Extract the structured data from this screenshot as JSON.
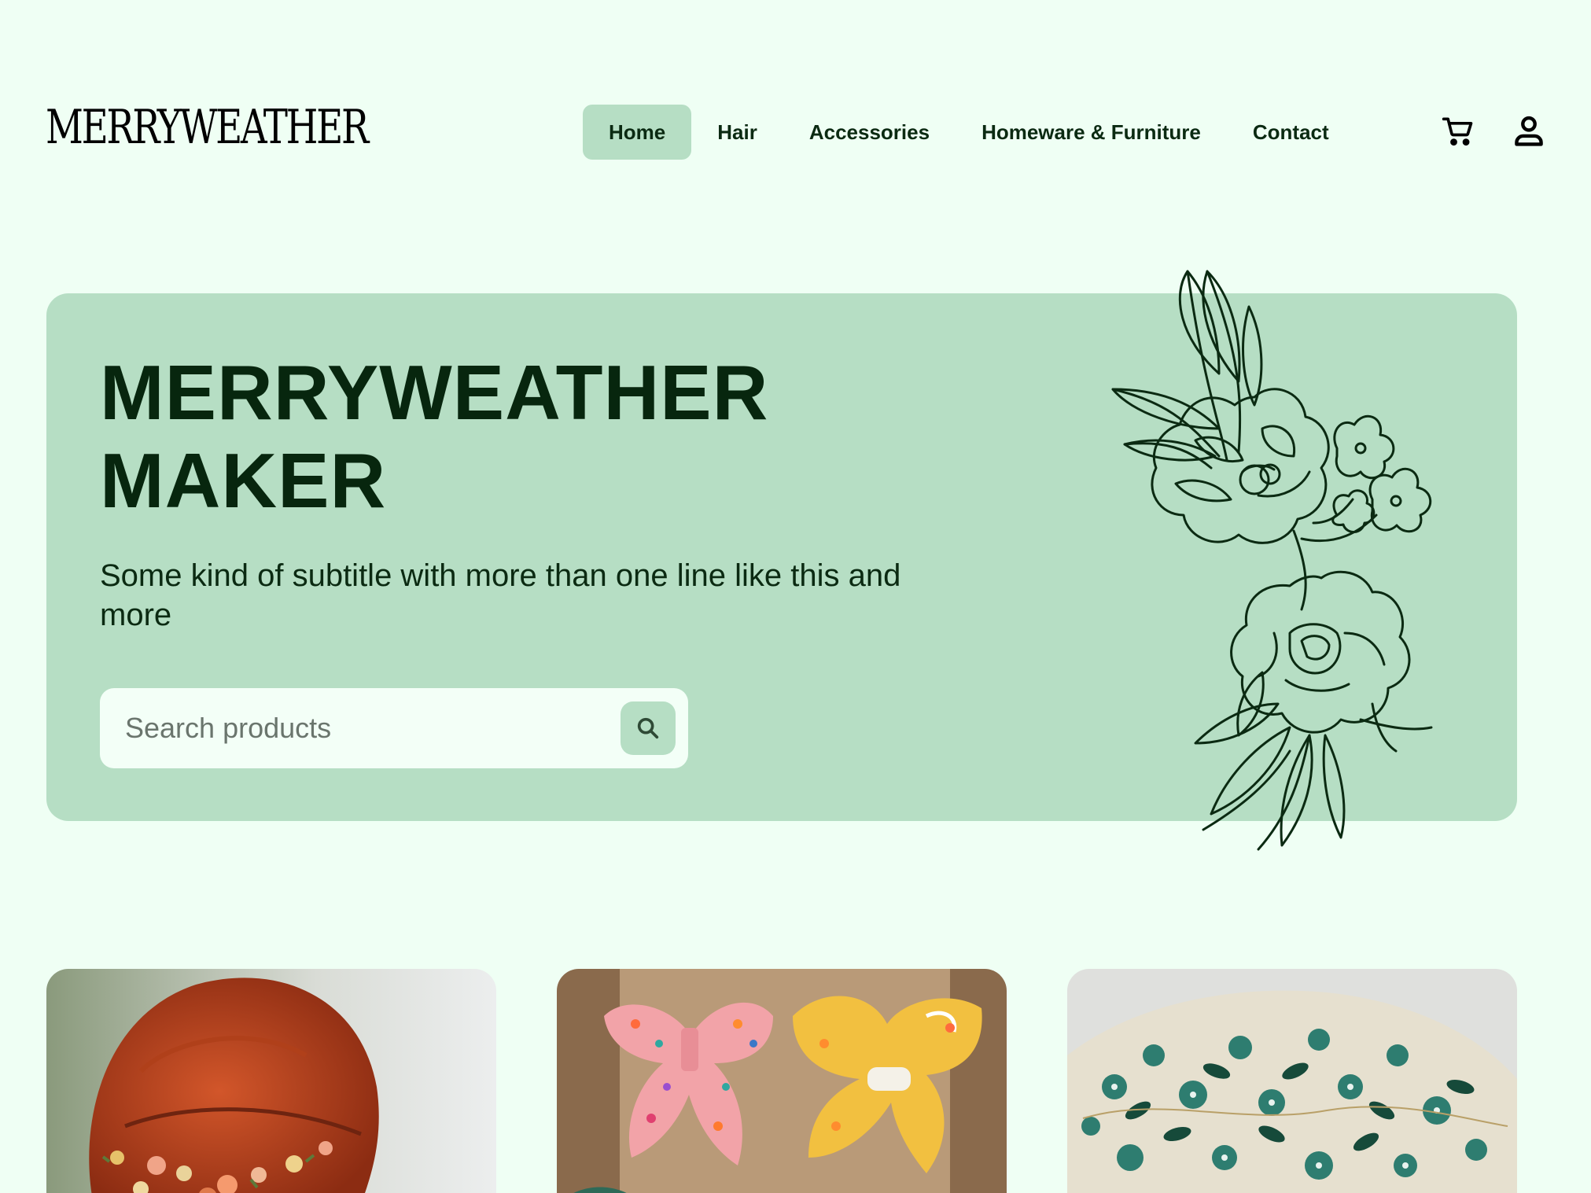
{
  "brand": {
    "logo_text": "MERRYWEATHER"
  },
  "nav": {
    "items": [
      {
        "label": "Home",
        "active": true
      },
      {
        "label": "Hair",
        "active": false
      },
      {
        "label": "Accessories",
        "active": false
      },
      {
        "label": "Homeware & Furniture",
        "active": false
      },
      {
        "label": "Contact",
        "active": false
      }
    ]
  },
  "header_icons": {
    "cart": "cart-icon",
    "account": "user-icon"
  },
  "hero": {
    "title_line1": "MERRYWEATHER",
    "title_line2": "MAKER",
    "subtitle": "Some kind of subtitle with more than one line like this and more",
    "search": {
      "placeholder": "Search products",
      "value": "",
      "button_icon": "search-icon"
    },
    "illustration": "floral-line-art"
  },
  "products": [
    {
      "image": "red-hair-flower-crown-photo"
    },
    {
      "image": "fabric-hair-bows-photo"
    },
    {
      "image": "floral-fabric-hat-photo"
    }
  ],
  "colors": {
    "page_background": "#effff4",
    "accent": "#b6dec4",
    "text_dark": "#07260e",
    "search_background": "#f3fff7"
  }
}
